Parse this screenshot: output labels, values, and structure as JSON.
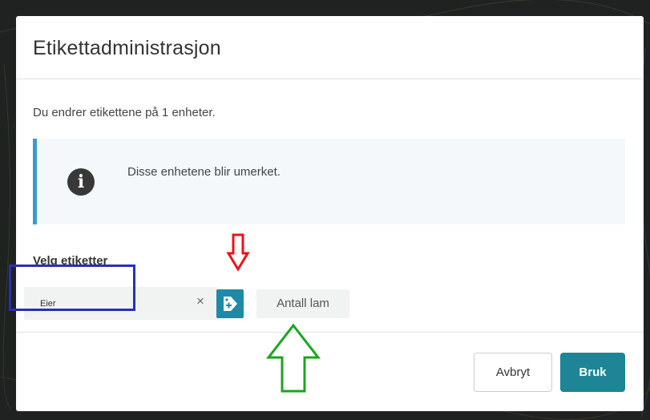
{
  "modal": {
    "title": "Etikettadministrasjon",
    "intro": "Du endrer etikettene på 1 enheter."
  },
  "info": {
    "icon": "info-icon",
    "glyph": "i",
    "text": "Disse enhetene blir umerket."
  },
  "tags": {
    "label": "Velg etiketter",
    "input_value": "Eier",
    "clear_glyph": "×",
    "add_icon": "tag-add-icon",
    "chips": [
      "Antall lam"
    ]
  },
  "footer": {
    "cancel_label": "Avbryt",
    "apply_label": "Bruk"
  },
  "annotations": {
    "red_arrow_icon": "arrow-down-icon",
    "green_arrow_icon": "arrow-up-icon",
    "highlight_color": "#2631b3",
    "red_arrow_color": "#e8131a",
    "green_arrow_color": "#1aa51f"
  },
  "colors": {
    "accent": "#1d8596",
    "info_border": "#3d98d6",
    "info_bg": "#f4f8fb"
  }
}
